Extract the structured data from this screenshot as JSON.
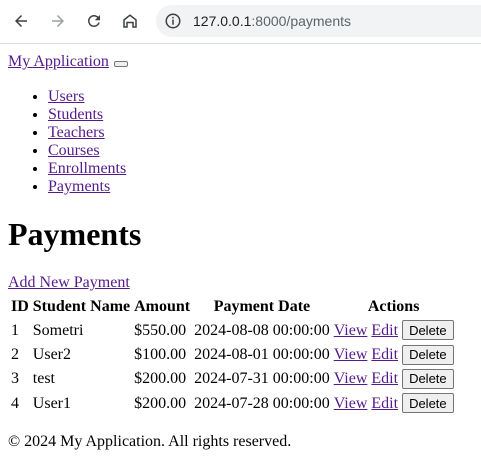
{
  "browser": {
    "url_host": "127.0.0.1",
    "url_rest": ":8000/payments"
  },
  "nav": {
    "brand": "My Application",
    "items": [
      "Users",
      "Students",
      "Teachers",
      "Courses",
      "Enrollments",
      "Payments"
    ]
  },
  "main": {
    "title": "Payments",
    "add_link": "Add New Payment",
    "table": {
      "headers": [
        "ID",
        "Student Name",
        "Amount",
        "Payment Date",
        "Actions"
      ],
      "rows": [
        {
          "id": "1",
          "student": "Sometri",
          "amount": "$550.00",
          "date": "2024-08-08 00:00:00"
        },
        {
          "id": "2",
          "student": "User2",
          "amount": "$100.00",
          "date": "2024-08-01 00:00:00"
        },
        {
          "id": "3",
          "student": "test",
          "amount": "$200.00",
          "date": "2024-07-31 00:00:00"
        },
        {
          "id": "4",
          "student": "User1",
          "amount": "$200.00",
          "date": "2024-07-28 00:00:00"
        }
      ],
      "view_label": "View",
      "edit_label": "Edit",
      "delete_label": "Delete"
    }
  },
  "footer": {
    "text": "© 2024 My Application. All rights reserved."
  }
}
